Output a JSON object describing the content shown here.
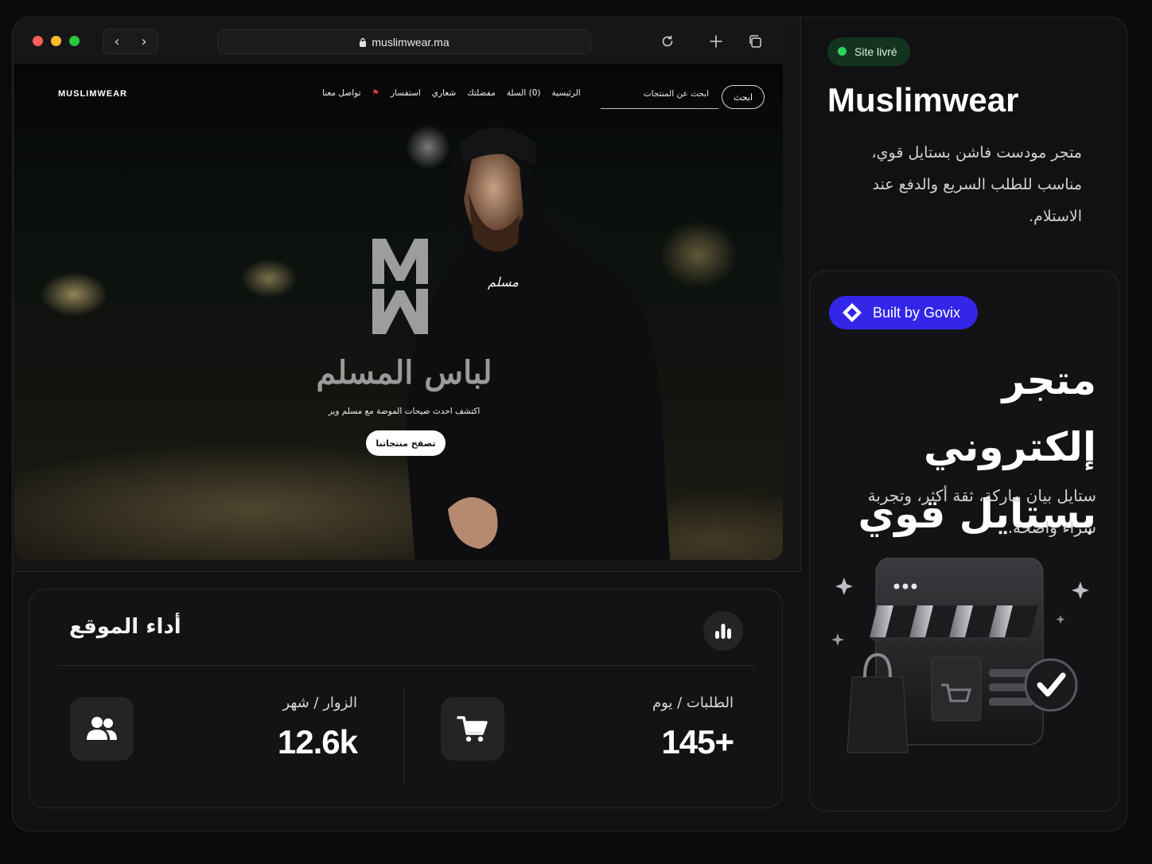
{
  "browser": {
    "url": "muslimwear.ma",
    "nav_back": "‹",
    "nav_forward": "›"
  },
  "site": {
    "logo": "MUSLIMWEAR",
    "nav": [
      "تواصل معنا",
      "استفسار",
      "شعاري",
      "مفضلتك",
      "(0) السلة",
      "الرئيسية"
    ],
    "search_placeholder": "ابحث عن المنتجات",
    "search_button": "ابحث",
    "hero_title": "لباس المسلم",
    "hero_subtitle": "اكتشف احدث صيحات الموضة مع مسلم وير",
    "hero_cta": "تصفح منتجاتنا"
  },
  "performance": {
    "title": "أداء الموقع",
    "stats": [
      {
        "label": "الطلبات / يوم",
        "value": "145+",
        "icon": "cart-icon"
      },
      {
        "label": "الزوار / شهر",
        "value": "12.6k",
        "icon": "users-icon"
      }
    ]
  },
  "panel": {
    "status_badge": "Site livré",
    "brand": "Muslimwear",
    "description": "متجر مودست فاشن بستايل قوي، مناسب للطلب السريع والدفع عند الاستلام.",
    "built_by": "Built by Govix",
    "promo_title": "متجر إلكتروني بستايل قوي",
    "promo_desc": "ستايل بيان ماركة، ثقة أكثر، وتجربة شراء واضحة."
  },
  "colors": {
    "status_green": "#2fd35a",
    "govix_blue": "#3426e8",
    "background": "#0a0a0b"
  }
}
